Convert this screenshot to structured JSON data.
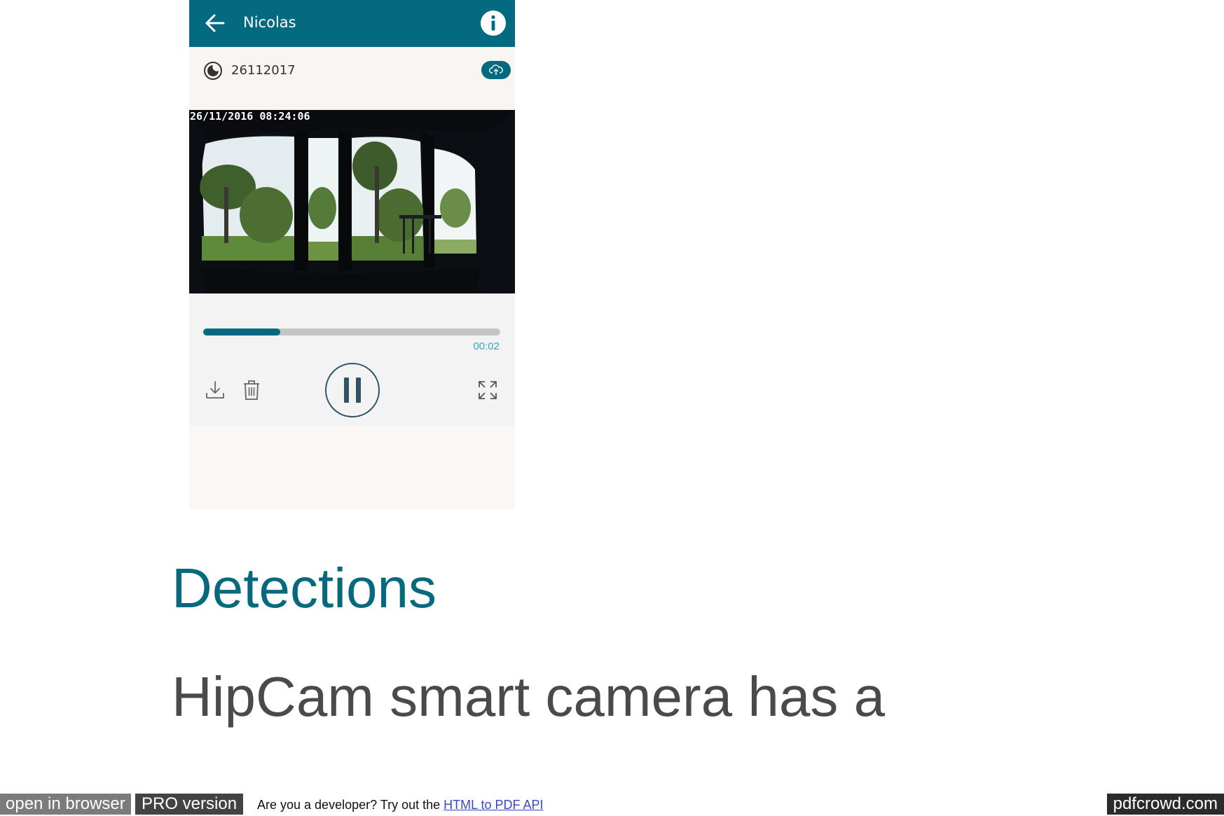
{
  "app": {
    "title": "Nicolas",
    "file_name": "26112017",
    "video_timestamp": "26/11/2016 08:24:06",
    "elapsed_time": "00:02",
    "progress_fraction": 0.26,
    "accent_color": "#046a80",
    "icons": {
      "back": "arrow-left-icon",
      "info": "info-icon",
      "mode": "moon-icon",
      "cloud": "cloud-upload-icon",
      "download": "download-icon",
      "delete": "trash-icon",
      "pause": "pause-icon",
      "fullscreen": "fullscreen-icon"
    }
  },
  "article": {
    "heading": "Detections",
    "paragraph": "HipCam smart camera has a"
  },
  "footer": {
    "open_in_browser": "open in browser",
    "pro_version": "PRO version",
    "developer_prompt": "Are you a developer? Try out the ",
    "api_link": "HTML to PDF API",
    "brand": "pdfcrowd.com"
  }
}
